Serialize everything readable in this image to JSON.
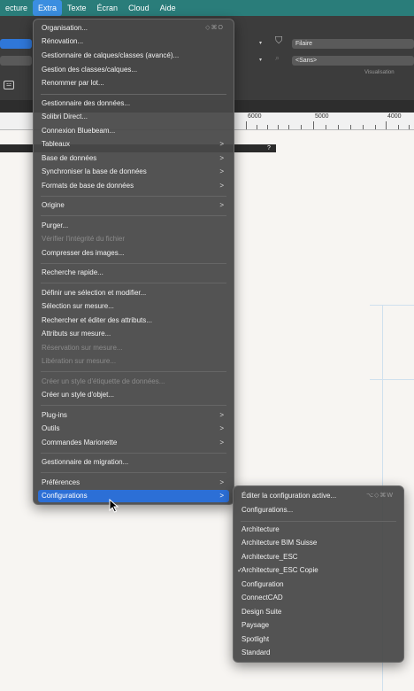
{
  "menubar": {
    "items": [
      "ecture",
      "Extra",
      "Texte",
      "Écran",
      "Cloud",
      "Aide"
    ],
    "active": "Extra"
  },
  "toolbar": {
    "class_field": "Filaire",
    "layer_field": "<Sans>",
    "visualisation_label": "Visualisation"
  },
  "ruler": {
    "labels": [
      "6000",
      "5000",
      "4000"
    ]
  },
  "canvas": {
    "help_mark": "?"
  },
  "extra_menu": {
    "items": [
      {
        "label": "Organisation...",
        "shortcut": "◇⌘O"
      },
      {
        "label": "Rénovation..."
      },
      {
        "label": "Gestionnaire de calques/classes (avancé)..."
      },
      {
        "label": "Gestion des classes/calques..."
      },
      {
        "label": "Renommer par lot..."
      },
      {
        "label": "Gestionnaire des données..."
      },
      {
        "label": "Solibri Direct..."
      },
      {
        "label": "Connexion Bluebeam..."
      },
      {
        "label": "Tableaux",
        "submenu": true
      },
      {
        "label": "Base de données",
        "submenu": true
      },
      {
        "label": "Synchroniser la base de données",
        "submenu": true
      },
      {
        "label": "Formats de base de données",
        "submenu": true
      },
      {
        "label": "Origine",
        "submenu": true
      },
      {
        "label": "Purger..."
      },
      {
        "label": "Vérifier l'intégrité du fichier",
        "disabled": true
      },
      {
        "label": "Compresser des images..."
      },
      {
        "label": "Recherche rapide..."
      },
      {
        "label": "Définir une sélection et modifier..."
      },
      {
        "label": "Sélection sur mesure..."
      },
      {
        "label": "Rechercher et éditer des attributs..."
      },
      {
        "label": "Attributs sur mesure..."
      },
      {
        "label": "Réservation sur mesure...",
        "disabled": true
      },
      {
        "label": "Libération sur mesure...",
        "disabled": true
      },
      {
        "label": "Créer un style d'étiquette de données...",
        "disabled": true
      },
      {
        "label": "Créer un style d'objet..."
      },
      {
        "label": "Plug-ins",
        "submenu": true
      },
      {
        "label": "Outils",
        "submenu": true
      },
      {
        "label": "Commandes Marionette",
        "submenu": true
      },
      {
        "label": "Gestionnaire de migration..."
      },
      {
        "label": "Préférences",
        "submenu": true
      },
      {
        "label": "Configurations",
        "submenu": true,
        "selected": true
      }
    ],
    "submenu_arrow": ">"
  },
  "configurations_menu": {
    "items": [
      {
        "label": "Éditer la configuration active...",
        "shortcut": "⌥◇⌘W"
      },
      {
        "label": "Configurations..."
      },
      {
        "label": "Architecture"
      },
      {
        "label": "Architecture BIM Suisse"
      },
      {
        "label": "Architecture_ESC"
      },
      {
        "label": "Architecture_ESC Copie",
        "checked": true
      },
      {
        "label": "Configuration"
      },
      {
        "label": "ConnectCAD"
      },
      {
        "label": "Design Suite"
      },
      {
        "label": "Paysage"
      },
      {
        "label": "Spotlight"
      },
      {
        "label": "Standard"
      }
    ],
    "checkmark": "✓"
  },
  "colors": {
    "menubar": "#2a7d7a",
    "selection": "#2c6fd6",
    "menu_bg": "#484848"
  }
}
